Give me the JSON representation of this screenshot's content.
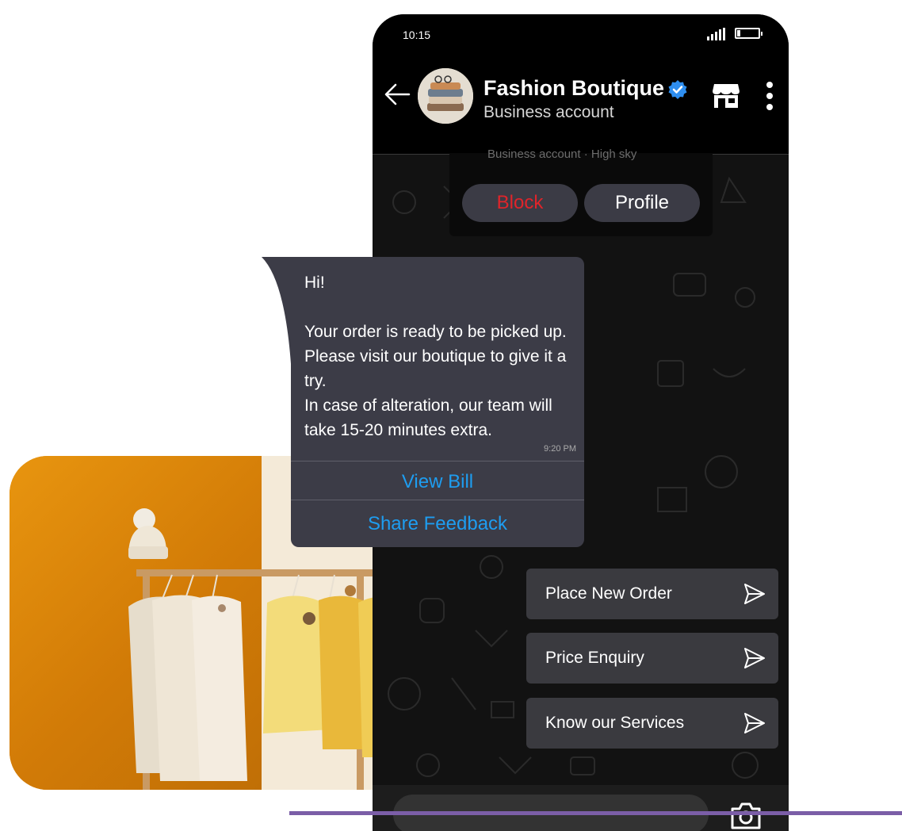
{
  "status_bar": {
    "time": "10:15"
  },
  "header": {
    "name": "Fashion Boutique",
    "subtitle": "Business account"
  },
  "profile_card": {
    "faded_text": "Business account · High sky",
    "block_label": "Block",
    "profile_label": "Profile"
  },
  "message": {
    "text": "Hi!\n\nYour order is ready to be picked up. Please visit our boutique to give it a try.\nIn case of alteration, our team will take 15-20 minutes extra.",
    "time": "9:20 PM",
    "buttons": [
      "View Bill",
      "Share Feedback"
    ]
  },
  "quick_replies": [
    "Place New Order",
    "Price Enquiry",
    "Know our Services"
  ],
  "colors": {
    "accent_link": "#1e9df0",
    "block_red": "#e0242a",
    "verified_blue": "#2e8ef0",
    "bubble": "#3c3c47",
    "divider_purple": "#7b5ea7"
  },
  "icons": [
    "back-arrow-icon",
    "verified-badge-icon",
    "store-icon",
    "more-vertical-icon",
    "send-icon",
    "camera-icon",
    "signal-icon",
    "battery-icon"
  ]
}
